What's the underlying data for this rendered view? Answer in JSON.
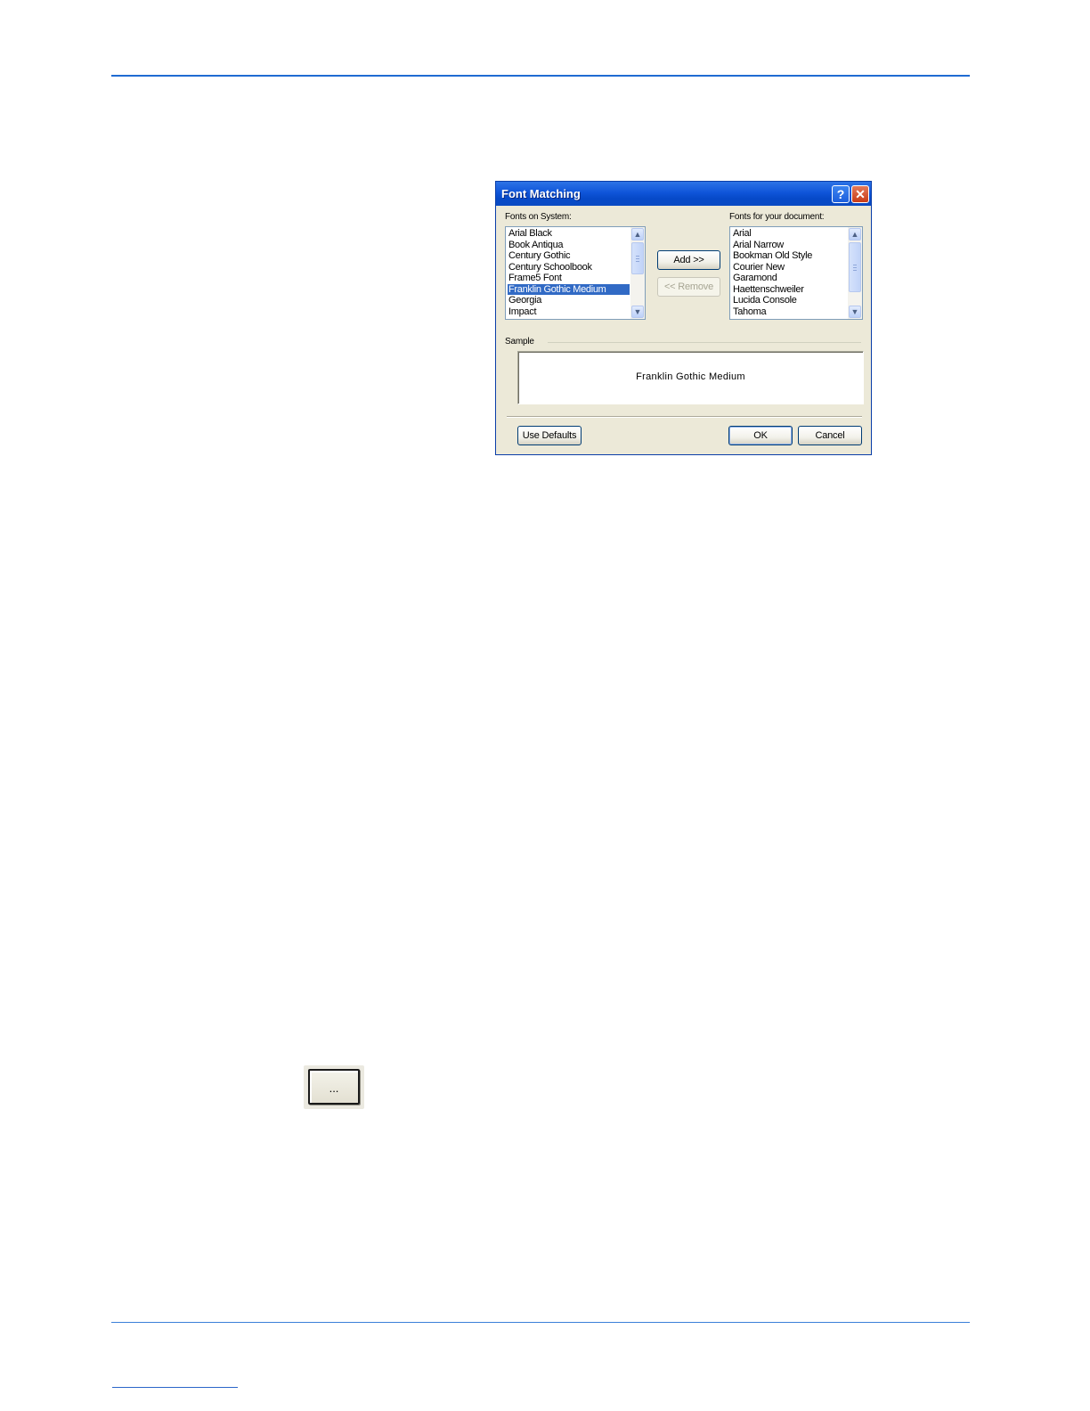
{
  "dialog": {
    "title": "Font Matching",
    "help_glyph": "?",
    "close_glyph": "✕",
    "fonts_on_system_label": "Fonts on System:",
    "fonts_on_system": [
      "Arial Black",
      "Book Antiqua",
      "Century Gothic",
      "Century Schoolbook",
      "Frame5 Font",
      "Franklin Gothic Medium",
      "Georgia",
      "Impact"
    ],
    "selected_system_font": "Franklin Gothic Medium",
    "fonts_for_document_label": "Fonts for your document:",
    "fonts_for_document": [
      "Arial",
      "Arial Narrow",
      "Bookman Old Style",
      "Courier New",
      "Garamond",
      "Haettenschweiler",
      "Lucida Console",
      "Tahoma"
    ],
    "add_label": "Add >>",
    "remove_label": "<< Remove",
    "sample_label": "Sample",
    "sample_text": "Franklin Gothic Medium",
    "use_defaults_label": "Use Defaults",
    "ok_label": "OK",
    "cancel_label": "Cancel",
    "scroll_up_glyph": "▲",
    "scroll_down_glyph": "▼"
  },
  "ellipsis_button": {
    "label": "..."
  },
  "colors": {
    "rule": "#1f6bd2",
    "titlebar": "#0f55d9",
    "selection": "#316ac5",
    "dialog_bg": "#ece9d8"
  }
}
